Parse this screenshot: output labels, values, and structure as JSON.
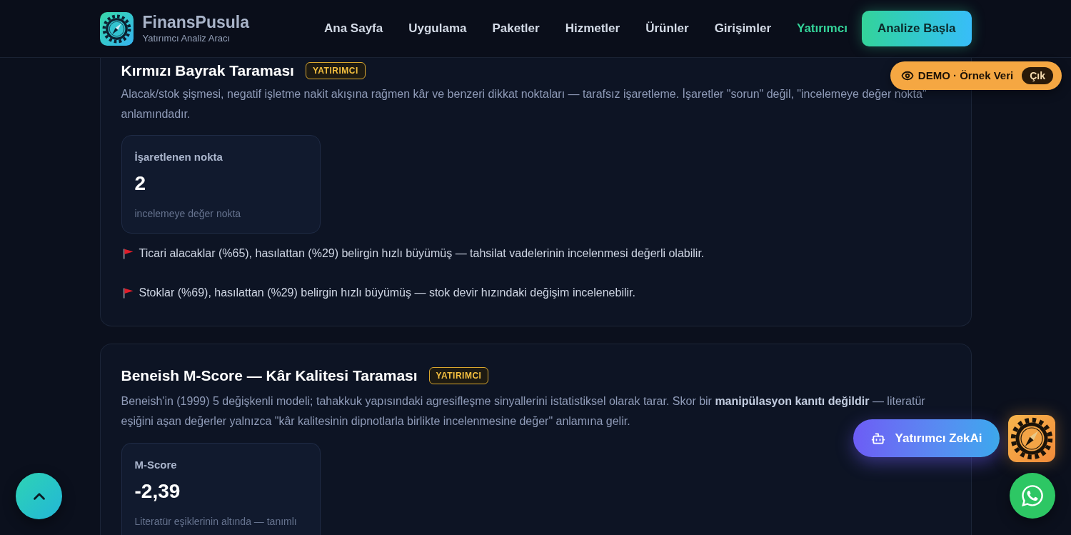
{
  "header": {
    "brand": {
      "name": "FinansPusula",
      "tagline": "Yatırımcı Analiz Aracı"
    },
    "nav": [
      {
        "label": "Ana Sayfa",
        "selected": false
      },
      {
        "label": "Uygulama",
        "selected": false
      },
      {
        "label": "Paketler",
        "selected": false
      },
      {
        "label": "Hizmetler",
        "selected": false
      },
      {
        "label": "Ürünler",
        "selected": false
      },
      {
        "label": "Girişimler",
        "selected": false
      },
      {
        "label": "Yatırımcı",
        "selected": true
      }
    ],
    "cta": "Analize Başla"
  },
  "demo_banner": {
    "label": "DEMO · Örnek Veri",
    "exit": "Çık"
  },
  "sections": [
    {
      "title": "Kırmızı Bayrak Taraması",
      "badge": "YATIRIMCI",
      "description": "Alacak/stok şişmesi, negatif işletme nakit akışına rağmen kâr ve benzeri dikkat noktaları — tarafsız işaretleme. İşaretler \"sorun\" değil, \"incelemeye değer nokta\" anlamındadır.",
      "stat": {
        "label": "İşaretlenen nokta",
        "value": "2",
        "note": "incelemeye değer nokta"
      },
      "flags": [
        "Ticari alacaklar (%65), hasılattan (%29) belirgin hızlı büyümüş — tahsilat vadelerinin incelenmesi değerli olabilir.",
        "Stoklar (%69), hasılattan (%29) belirgin hızlı büyümüş — stok devir hızındaki değişim incelenebilir."
      ]
    },
    {
      "title": "Beneish M-Score — Kâr Kalitesi Taraması",
      "badge": "YATIRIMCI",
      "description": "Beneish'in (1999) 5 değişkenli modeli; tahakkuk yapısındaki agresifleşme sinyallerini istatistiksel olarak tarar. Skor bir **manipülasyon kanıtı değildir** — literatür eşiğini aşan değerler yalnızca \"kâr kalitesinin dipnotlarla birlikte incelenmesine değer\" anlamına gelir.",
      "stat": {
        "label": "M-Score",
        "value": "-2,39",
        "note": "Literatür eşiklerinin altında — tanımlı"
      }
    }
  ],
  "assistant": {
    "label": "Yatırımcı ZekAi"
  }
}
